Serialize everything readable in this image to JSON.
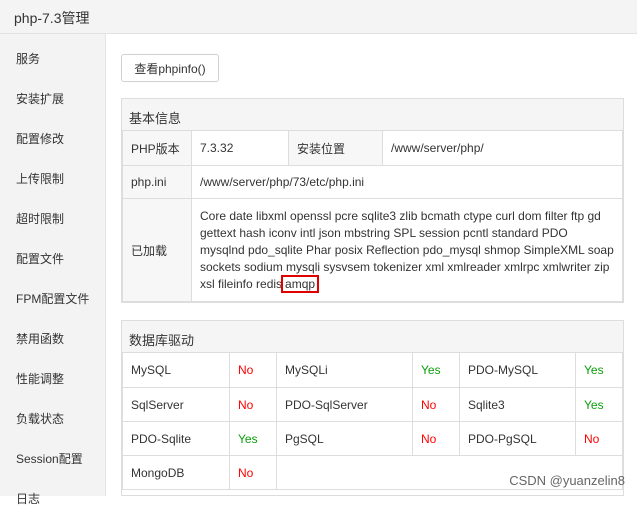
{
  "window": {
    "title": "php-7.3管理"
  },
  "sidebar": {
    "items": [
      {
        "label": "服务"
      },
      {
        "label": "安装扩展"
      },
      {
        "label": "配置修改"
      },
      {
        "label": "上传限制"
      },
      {
        "label": "超时限制"
      },
      {
        "label": "配置文件"
      },
      {
        "label": "FPM配置文件"
      },
      {
        "label": "禁用函数"
      },
      {
        "label": "性能调整"
      },
      {
        "label": "负载状态"
      },
      {
        "label": "Session配置"
      },
      {
        "label": "日志"
      }
    ]
  },
  "toolbar": {
    "phpinfo_label": "查看phpinfo()"
  },
  "basic": {
    "title": "基本信息",
    "version_label": "PHP版本",
    "version_value": "7.3.32",
    "location_label": "安装位置",
    "location_value": "/www/server/php/",
    "ini_label": "php.ini",
    "ini_value": "/www/server/php/73/etc/php.ini",
    "loaded_label": "已加载",
    "loaded_value": "Core date libxml openssl pcre sqlite3 zlib bcmath ctype curl dom filter ftp gd gettext hash iconv intl json mbstring SPL session pcntl standard PDO mysqlnd pdo_sqlite Phar posix Reflection pdo_mysql shmop SimpleXML soap sockets sodium mysqli sysvsem tokenizer xml xmlreader xmlrpc xmlwriter zip xsl fileinfo redis",
    "loaded_highlight": "amqp"
  },
  "drivers": {
    "title": "数据库驱动",
    "rows": [
      [
        {
          "name": "MySQL",
          "status": "No"
        },
        {
          "name": "MySQLi",
          "status": "Yes"
        },
        {
          "name": "PDO-MySQL",
          "status": "Yes"
        }
      ],
      [
        {
          "name": "SqlServer",
          "status": "No"
        },
        {
          "name": "PDO-SqlServer",
          "status": "No"
        },
        {
          "name": "Sqlite3",
          "status": "Yes"
        }
      ],
      [
        {
          "name": "PDO-Sqlite",
          "status": "Yes"
        },
        {
          "name": "PgSQL",
          "status": "No"
        },
        {
          "name": "PDO-PgSQL",
          "status": "No"
        }
      ],
      [
        {
          "name": "MongoDB",
          "status": "No"
        }
      ]
    ]
  },
  "watermark": "CSDN @yuanzelin8",
  "colors": {
    "yes": "#0a9e0a",
    "no": "#ff0000",
    "highlight_border": "#e00000"
  }
}
